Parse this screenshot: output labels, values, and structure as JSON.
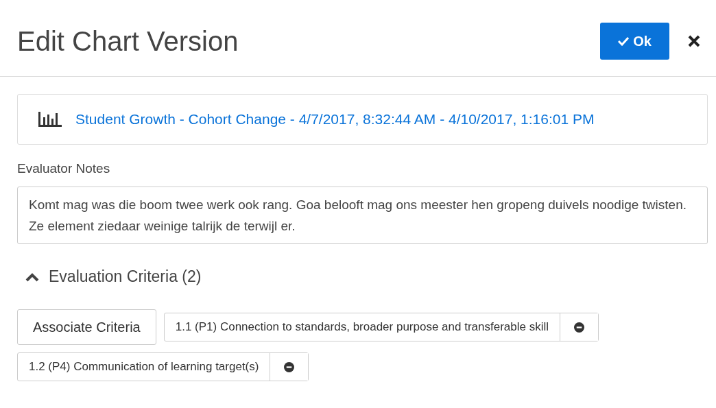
{
  "dialog": {
    "title": "Edit Chart Version",
    "ok_button": "Ok"
  },
  "chart_link": {
    "label": "Student Growth - Cohort Change - 4/7/2017, 8:32:44 AM - 4/10/2017, 1:16:01 PM"
  },
  "notes": {
    "label": "Evaluator Notes",
    "value": "Komt mag was die boom twee werk ook rang. Goa belooft mag ons meester hen gropeng duivels noodige twisten. Ze element ziedaar weinige talrijk de terwijl er."
  },
  "criteria_section": {
    "title": "Evaluation Criteria (2)",
    "expanded": true,
    "associate_button": "Associate Criteria",
    "items": [
      {
        "label": "1.1 (P1) Connection to standards, broader purpose and transferable skill"
      },
      {
        "label": "1.2 (P4) Communication of learning target(s)"
      }
    ]
  }
}
